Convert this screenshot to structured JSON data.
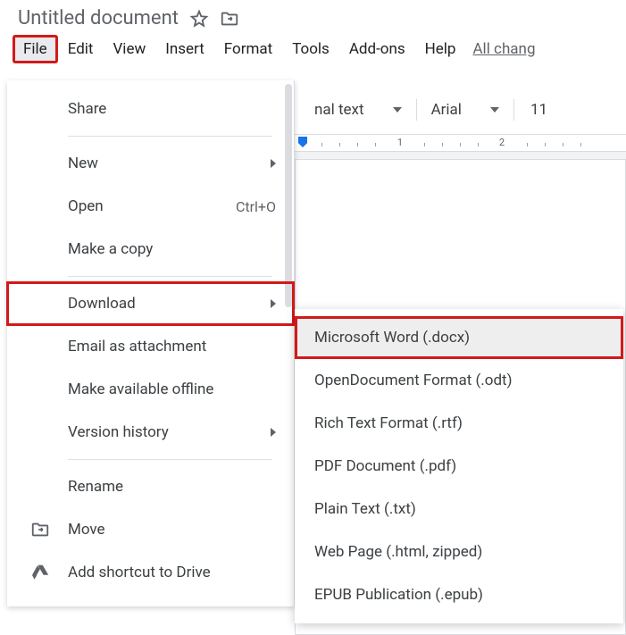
{
  "header": {
    "title": "Untitled document"
  },
  "menu": {
    "file": "File",
    "edit": "Edit",
    "view": "View",
    "insert": "Insert",
    "format": "Format",
    "tools": "Tools",
    "addons": "Add-ons",
    "help": "Help",
    "changes": "All chang"
  },
  "toolbar": {
    "style": "nal text",
    "font": "Arial",
    "fontsize": "11"
  },
  "ruler": {
    "n1": "1",
    "n2": "2"
  },
  "file_menu": {
    "share": "Share",
    "new": "New",
    "open": "Open",
    "open_shortcut": "Ctrl+O",
    "make_copy": "Make a copy",
    "download": "Download",
    "email_attachment": "Email as attachment",
    "available_offline": "Make available offline",
    "version_history": "Version history",
    "rename": "Rename",
    "move": "Move",
    "add_shortcut": "Add shortcut to Drive"
  },
  "download_submenu": {
    "docx": "Microsoft Word (.docx)",
    "odt": "OpenDocument Format (.odt)",
    "rtf": "Rich Text Format (.rtf)",
    "pdf": "PDF Document (.pdf)",
    "txt": "Plain Text (.txt)",
    "html": "Web Page (.html, zipped)",
    "epub": "EPUB Publication (.epub)"
  }
}
